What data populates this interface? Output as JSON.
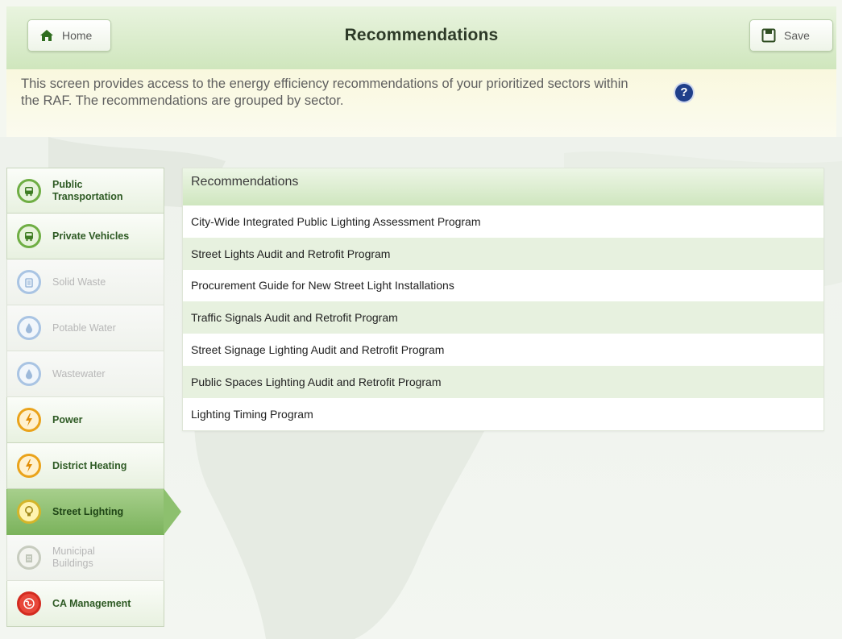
{
  "header": {
    "title": "Recommendations",
    "home_label": "Home",
    "save_label": "Save"
  },
  "info": {
    "text": "This screen provides access to the energy efficiency recommendations of your prioritized sectors within the RAF. The recommendations are grouped by sector.",
    "help_glyph": "?"
  },
  "sidebar": {
    "items": [
      {
        "label": "Public Transportation",
        "icon": "bus-icon",
        "state": "enabled"
      },
      {
        "label": "Private Vehicles",
        "icon": "car-icon",
        "state": "enabled"
      },
      {
        "label": "Solid Waste",
        "icon": "trash-bin-icon",
        "state": "disabled"
      },
      {
        "label": "Potable Water",
        "icon": "water-drop-icon",
        "state": "disabled"
      },
      {
        "label": "Wastewater",
        "icon": "water-drop-icon",
        "state": "disabled"
      },
      {
        "label": "Power",
        "icon": "lightning-bolt-icon",
        "state": "enabled"
      },
      {
        "label": "District Heating",
        "icon": "lightning-bolt-icon",
        "state": "enabled"
      },
      {
        "label": "Street Lighting",
        "icon": "light-bulb-icon",
        "state": "active"
      },
      {
        "label": "Municipal Buildings",
        "icon": "building-icon",
        "state": "disabled"
      },
      {
        "label": "CA Management",
        "icon": "globe-icon",
        "state": "enabled"
      }
    ]
  },
  "recommendations": {
    "header": "Recommendations",
    "items": [
      "City-Wide Integrated Public Lighting Assessment Program",
      "Street Lights Audit and Retrofit Program",
      "Procurement Guide for New Street Light Installations",
      "Traffic Signals Audit and Retrofit Program",
      "Street Signage Lighting Audit and Retrofit Program",
      "Public Spaces Lighting Audit and Retrofit Program",
      "Lighting Timing Program"
    ]
  },
  "colors": {
    "header_green": "#cfe6bd",
    "active_green": "#7bb35c",
    "info_yellow": "#f9f8de",
    "help_blue": "#1f3f8a"
  }
}
